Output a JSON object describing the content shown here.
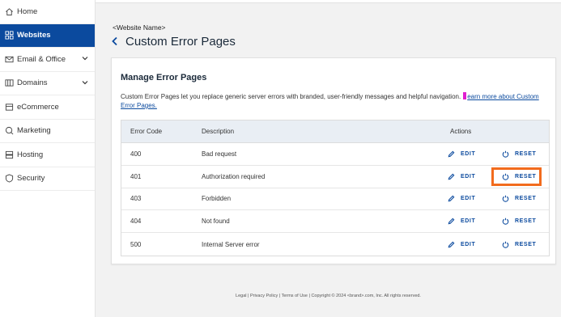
{
  "sidebar": {
    "items": [
      {
        "label": "Home",
        "icon": "home-icon",
        "active": false,
        "expandable": false
      },
      {
        "label": "Websites",
        "icon": "grid-icon",
        "active": true,
        "expandable": false
      },
      {
        "label": "Email & Office",
        "icon": "mail-icon",
        "active": false,
        "expandable": true
      },
      {
        "label": "Domains",
        "icon": "domains-icon",
        "active": false,
        "expandable": true
      },
      {
        "label": "eCommerce",
        "icon": "store-icon",
        "active": false,
        "expandable": false
      },
      {
        "label": "Marketing",
        "icon": "marketing-icon",
        "active": false,
        "expandable": false
      },
      {
        "label": "Hosting",
        "icon": "server-icon",
        "active": false,
        "expandable": false
      },
      {
        "label": "Security",
        "icon": "shield-icon",
        "active": false,
        "expandable": false
      }
    ]
  },
  "header": {
    "site_name": "<Website Name>",
    "title": "Custom Error Pages"
  },
  "card": {
    "title": "Manage Error Pages",
    "description": "Custom Error Pages let you replace generic server errors with branded, user-friendly messages and helpful navigation.",
    "link_text": "earn more about Custom Error Pages."
  },
  "table": {
    "headers": {
      "code": "Error Code",
      "description": "Description",
      "actions": "Actions"
    },
    "rows": [
      {
        "code": "400",
        "description": "Bad request"
      },
      {
        "code": "401",
        "description": "Authorization required"
      },
      {
        "code": "403",
        "description": "Forbidden"
      },
      {
        "code": "404",
        "description": "Not found"
      },
      {
        "code": "500",
        "description": "Internal Server error"
      }
    ],
    "edit_label": "EDIT",
    "reset_label": "RESET",
    "highlighted_row": 1
  },
  "footer": {
    "text": "Legal  |  Privacy Policy  |  Terms of Use  |  Copyright © 2024 <brand>.com, Inc. All rights reserved."
  },
  "colors": {
    "brand": "#0b4a9e",
    "highlight": "#f26b1d",
    "cursor": "#e020d0"
  }
}
